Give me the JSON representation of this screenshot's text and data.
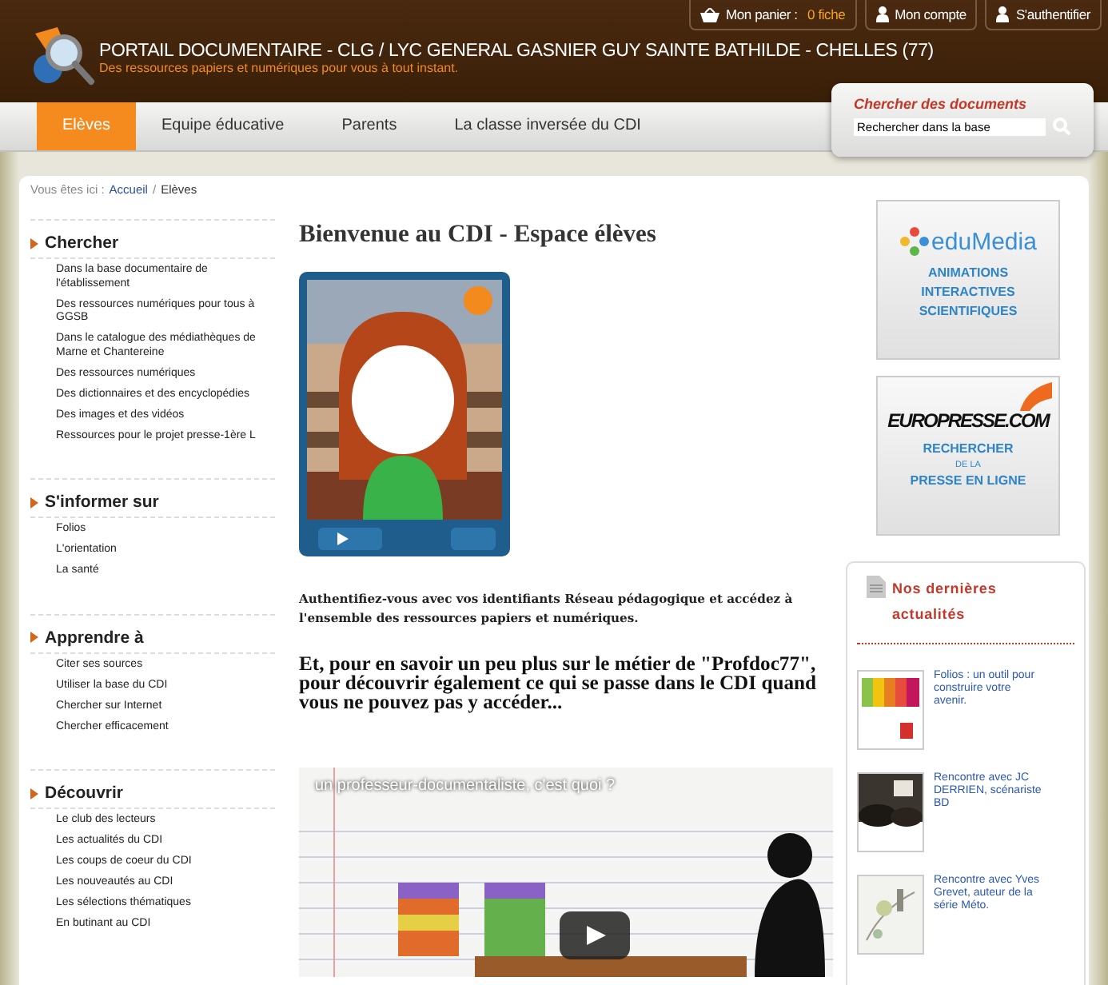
{
  "top_links": {
    "cart_label": "Mon panier :",
    "cart_count": "0 fiche",
    "links": [
      "Mon compte",
      "S'authentifier"
    ]
  },
  "header": {
    "title": "PORTAIL DOCUMENTAIRE - CLG / LYC GENERAL GASNIER GUY SAINTE BATHILDE - CHELLES (77)",
    "subtitle": "Des ressources papiers et numériques pour vous à tout instant."
  },
  "tabs": [
    {
      "label": "Elèves",
      "selected": true
    },
    {
      "label": "Equipe éducative",
      "selected": false
    },
    {
      "label": "Parents",
      "selected": false
    },
    {
      "label": "La classe inversée du CDI",
      "selected": false
    }
  ],
  "search": {
    "title": "Chercher des documents",
    "placeholder": "Rechercher dans la base"
  },
  "breadcrumb": {
    "prefix": "Vous êtes ici :",
    "link": "Accueil",
    "separator": "/",
    "current": "Elèves"
  },
  "sidebar": {
    "sections": [
      {
        "title": "Chercher",
        "items": [
          "Dans la base documentaire de l'établissement",
          "Des ressources numériques pour tous à GGSB",
          "Dans le catalogue des médiathèques de Marne et Chantereine",
          "Des ressources numériques",
          "Des dictionnaires et des encyclopédies",
          "Des images et des vidéos",
          "Ressources pour le projet presse-1ère L"
        ]
      },
      {
        "title": "S'informer sur",
        "items": [
          "Folios",
          "L'orientation",
          "La santé"
        ]
      },
      {
        "title": "Apprendre à",
        "items": [
          "Citer ses sources",
          "Utiliser la base du CDI",
          "Chercher sur Internet",
          "Chercher efficacement"
        ]
      },
      {
        "title": "Découvrir",
        "items": [
          "Le club des lecteurs",
          "Les actualités du CDI",
          "Les coups de coeur du CDI",
          "Les nouveautés au CDI",
          "Les sélections thématiques",
          "En butinant au CDI"
        ]
      }
    ]
  },
  "main": {
    "heading": "Bienvenue au CDI - Espace élèves",
    "intro": "Authentifiez-vous avec vos identifiants Réseau pédagogique et accédez à l'ensemble des ressources papiers et numériques.",
    "paragraph": "Et, pour en savoir un peu plus sur le métier de \"Profdoc77\", pour découvrir également ce qui se passe dans le CDI quand vous ne pouvez pas y accéder...",
    "video": {
      "title": "un professeur-documentaliste, c'est quoi ?"
    }
  },
  "banners": [
    {
      "kind": "edumedia",
      "logo": "eduMedia",
      "lines": [
        "ANIMATIONS",
        "INTERACTIVES",
        "SCIENTIFIQUES"
      ]
    },
    {
      "kind": "europresse",
      "logo": "EUROPRESSE.COM",
      "lines": [
        "RECHERCHER",
        "DE LA",
        "PRESSE EN LIGNE"
      ]
    }
  ],
  "news": {
    "title": "Nos dernières actualités",
    "items": [
      {
        "text": "Folios : un outil pour construire votre avenir."
      },
      {
        "text": "Rencontre avec JC DERRIEN, scénariste BD"
      },
      {
        "text": "Rencontre avec Yves Grevet, auteur de la série Méto."
      }
    ]
  }
}
